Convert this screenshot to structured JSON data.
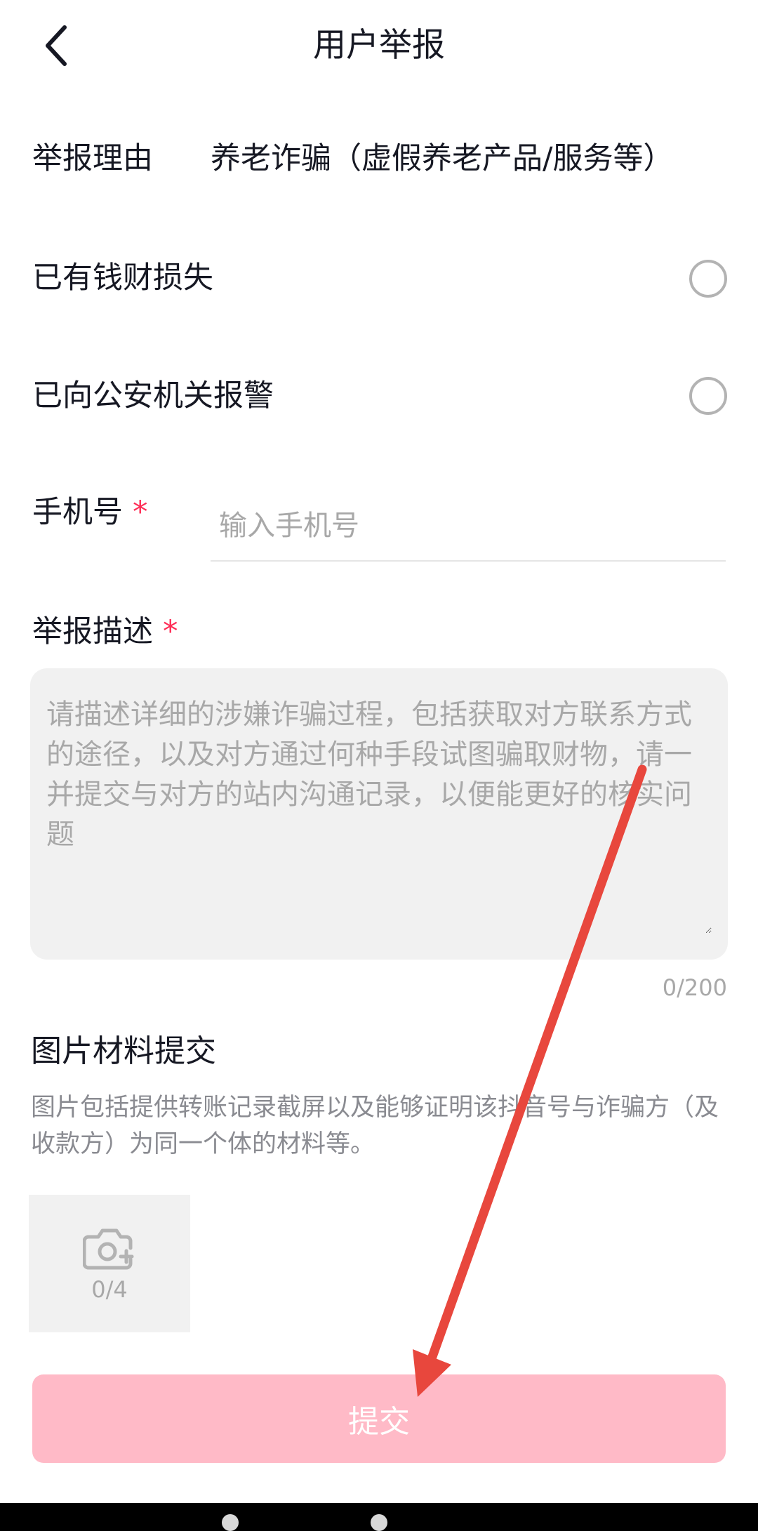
{
  "header": {
    "title": "用户举报"
  },
  "reason": {
    "label": "举报理由",
    "value": "养老诈骗（虚假养老产品/服务等）"
  },
  "options": [
    {
      "label": "已有钱财损失"
    },
    {
      "label": "已向公安机关报警"
    }
  ],
  "phone": {
    "label": "手机号",
    "required_mark": "*",
    "placeholder": "输入手机号"
  },
  "description": {
    "label": "举报描述",
    "required_mark": "*",
    "placeholder": "请描述详细的涉嫌诈骗过程，包括获取对方联系方式的途径，以及对方通过何种手段试图骗取财物，请一并提交与对方的站内沟通记录，以便能更好的核实问题",
    "counter": "0/200"
  },
  "images": {
    "title": "图片材料提交",
    "desc": "图片包括提供转账记录截屏以及能够证明该抖音号与诈骗方（及收款方）为同一个体的材料等。",
    "count": "0/4"
  },
  "submit": {
    "label": "提交"
  },
  "icons": {
    "back": "back-chevron-icon",
    "camera": "camera-add-icon"
  },
  "colors": {
    "accent": "#fe2c55",
    "submit_disabled": "#ffbac7",
    "annotation_arrow": "#e8473d"
  }
}
